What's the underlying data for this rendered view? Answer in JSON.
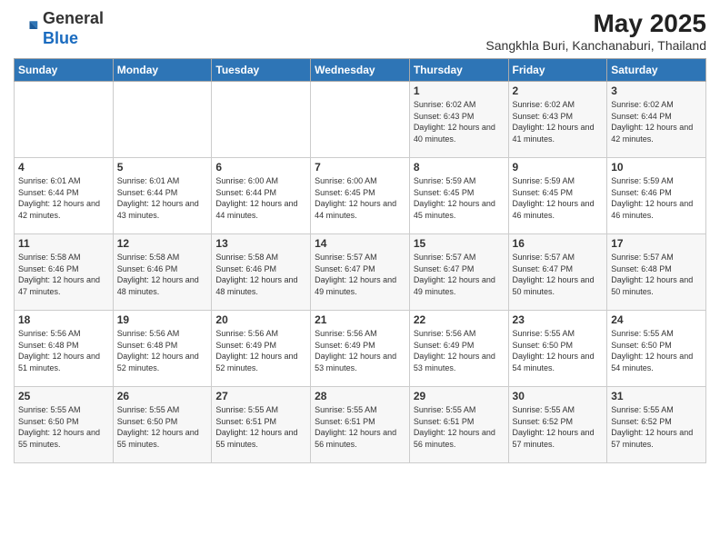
{
  "header": {
    "logo_general": "General",
    "logo_blue": "Blue",
    "month_year": "May 2025",
    "location": "Sangkhla Buri, Kanchanaburi, Thailand"
  },
  "weekdays": [
    "Sunday",
    "Monday",
    "Tuesday",
    "Wednesday",
    "Thursday",
    "Friday",
    "Saturday"
  ],
  "weeks": [
    [
      {
        "day": "",
        "sunrise": "",
        "sunset": "",
        "daylight": ""
      },
      {
        "day": "",
        "sunrise": "",
        "sunset": "",
        "daylight": ""
      },
      {
        "day": "",
        "sunrise": "",
        "sunset": "",
        "daylight": ""
      },
      {
        "day": "",
        "sunrise": "",
        "sunset": "",
        "daylight": ""
      },
      {
        "day": "1",
        "sunrise": "Sunrise: 6:02 AM",
        "sunset": "Sunset: 6:43 PM",
        "daylight": "Daylight: 12 hours and 40 minutes."
      },
      {
        "day": "2",
        "sunrise": "Sunrise: 6:02 AM",
        "sunset": "Sunset: 6:43 PM",
        "daylight": "Daylight: 12 hours and 41 minutes."
      },
      {
        "day": "3",
        "sunrise": "Sunrise: 6:02 AM",
        "sunset": "Sunset: 6:44 PM",
        "daylight": "Daylight: 12 hours and 42 minutes."
      }
    ],
    [
      {
        "day": "4",
        "sunrise": "Sunrise: 6:01 AM",
        "sunset": "Sunset: 6:44 PM",
        "daylight": "Daylight: 12 hours and 42 minutes."
      },
      {
        "day": "5",
        "sunrise": "Sunrise: 6:01 AM",
        "sunset": "Sunset: 6:44 PM",
        "daylight": "Daylight: 12 hours and 43 minutes."
      },
      {
        "day": "6",
        "sunrise": "Sunrise: 6:00 AM",
        "sunset": "Sunset: 6:44 PM",
        "daylight": "Daylight: 12 hours and 44 minutes."
      },
      {
        "day": "7",
        "sunrise": "Sunrise: 6:00 AM",
        "sunset": "Sunset: 6:45 PM",
        "daylight": "Daylight: 12 hours and 44 minutes."
      },
      {
        "day": "8",
        "sunrise": "Sunrise: 5:59 AM",
        "sunset": "Sunset: 6:45 PM",
        "daylight": "Daylight: 12 hours and 45 minutes."
      },
      {
        "day": "9",
        "sunrise": "Sunrise: 5:59 AM",
        "sunset": "Sunset: 6:45 PM",
        "daylight": "Daylight: 12 hours and 46 minutes."
      },
      {
        "day": "10",
        "sunrise": "Sunrise: 5:59 AM",
        "sunset": "Sunset: 6:46 PM",
        "daylight": "Daylight: 12 hours and 46 minutes."
      }
    ],
    [
      {
        "day": "11",
        "sunrise": "Sunrise: 5:58 AM",
        "sunset": "Sunset: 6:46 PM",
        "daylight": "Daylight: 12 hours and 47 minutes."
      },
      {
        "day": "12",
        "sunrise": "Sunrise: 5:58 AM",
        "sunset": "Sunset: 6:46 PM",
        "daylight": "Daylight: 12 hours and 48 minutes."
      },
      {
        "day": "13",
        "sunrise": "Sunrise: 5:58 AM",
        "sunset": "Sunset: 6:46 PM",
        "daylight": "Daylight: 12 hours and 48 minutes."
      },
      {
        "day": "14",
        "sunrise": "Sunrise: 5:57 AM",
        "sunset": "Sunset: 6:47 PM",
        "daylight": "Daylight: 12 hours and 49 minutes."
      },
      {
        "day": "15",
        "sunrise": "Sunrise: 5:57 AM",
        "sunset": "Sunset: 6:47 PM",
        "daylight": "Daylight: 12 hours and 49 minutes."
      },
      {
        "day": "16",
        "sunrise": "Sunrise: 5:57 AM",
        "sunset": "Sunset: 6:47 PM",
        "daylight": "Daylight: 12 hours and 50 minutes."
      },
      {
        "day": "17",
        "sunrise": "Sunrise: 5:57 AM",
        "sunset": "Sunset: 6:48 PM",
        "daylight": "Daylight: 12 hours and 50 minutes."
      }
    ],
    [
      {
        "day": "18",
        "sunrise": "Sunrise: 5:56 AM",
        "sunset": "Sunset: 6:48 PM",
        "daylight": "Daylight: 12 hours and 51 minutes."
      },
      {
        "day": "19",
        "sunrise": "Sunrise: 5:56 AM",
        "sunset": "Sunset: 6:48 PM",
        "daylight": "Daylight: 12 hours and 52 minutes."
      },
      {
        "day": "20",
        "sunrise": "Sunrise: 5:56 AM",
        "sunset": "Sunset: 6:49 PM",
        "daylight": "Daylight: 12 hours and 52 minutes."
      },
      {
        "day": "21",
        "sunrise": "Sunrise: 5:56 AM",
        "sunset": "Sunset: 6:49 PM",
        "daylight": "Daylight: 12 hours and 53 minutes."
      },
      {
        "day": "22",
        "sunrise": "Sunrise: 5:56 AM",
        "sunset": "Sunset: 6:49 PM",
        "daylight": "Daylight: 12 hours and 53 minutes."
      },
      {
        "day": "23",
        "sunrise": "Sunrise: 5:55 AM",
        "sunset": "Sunset: 6:50 PM",
        "daylight": "Daylight: 12 hours and 54 minutes."
      },
      {
        "day": "24",
        "sunrise": "Sunrise: 5:55 AM",
        "sunset": "Sunset: 6:50 PM",
        "daylight": "Daylight: 12 hours and 54 minutes."
      }
    ],
    [
      {
        "day": "25",
        "sunrise": "Sunrise: 5:55 AM",
        "sunset": "Sunset: 6:50 PM",
        "daylight": "Daylight: 12 hours and 55 minutes."
      },
      {
        "day": "26",
        "sunrise": "Sunrise: 5:55 AM",
        "sunset": "Sunset: 6:50 PM",
        "daylight": "Daylight: 12 hours and 55 minutes."
      },
      {
        "day": "27",
        "sunrise": "Sunrise: 5:55 AM",
        "sunset": "Sunset: 6:51 PM",
        "daylight": "Daylight: 12 hours and 55 minutes."
      },
      {
        "day": "28",
        "sunrise": "Sunrise: 5:55 AM",
        "sunset": "Sunset: 6:51 PM",
        "daylight": "Daylight: 12 hours and 56 minutes."
      },
      {
        "day": "29",
        "sunrise": "Sunrise: 5:55 AM",
        "sunset": "Sunset: 6:51 PM",
        "daylight": "Daylight: 12 hours and 56 minutes."
      },
      {
        "day": "30",
        "sunrise": "Sunrise: 5:55 AM",
        "sunset": "Sunset: 6:52 PM",
        "daylight": "Daylight: 12 hours and 57 minutes."
      },
      {
        "day": "31",
        "sunrise": "Sunrise: 5:55 AM",
        "sunset": "Sunset: 6:52 PM",
        "daylight": "Daylight: 12 hours and 57 minutes."
      }
    ]
  ]
}
